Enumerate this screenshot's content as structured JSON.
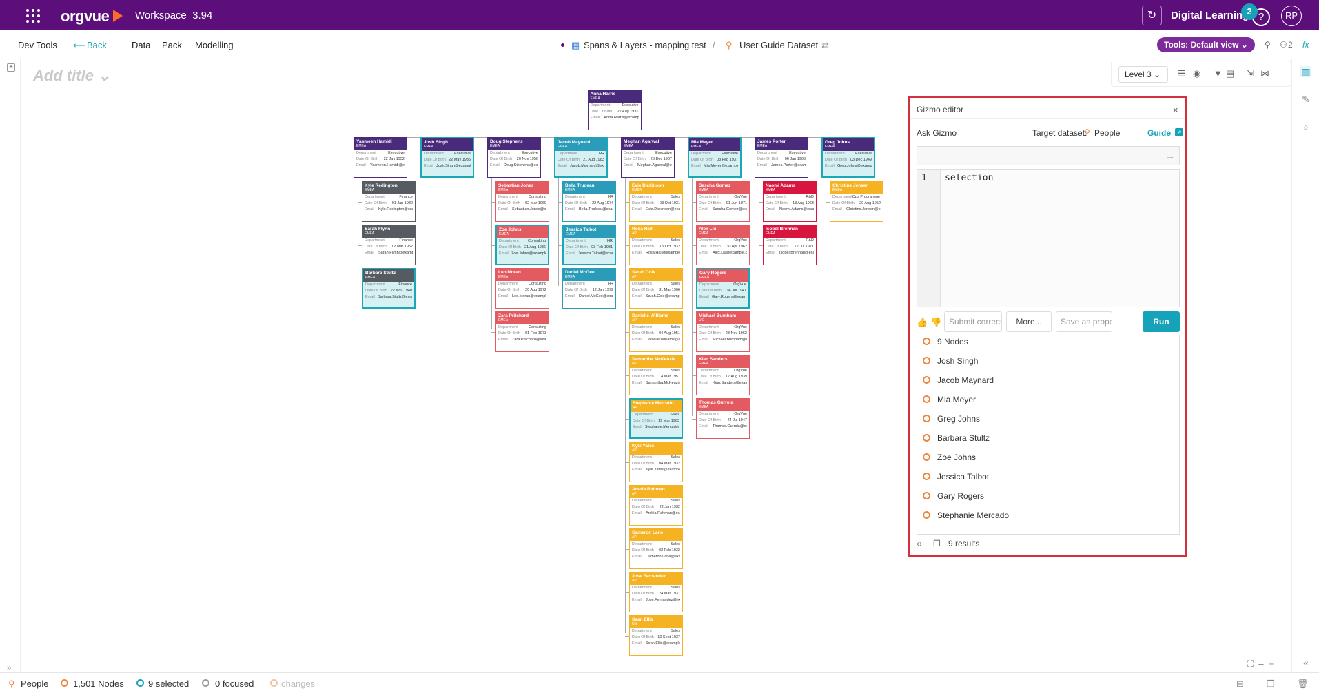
{
  "app": {
    "workspace_label": "Workspace",
    "version": "3.94",
    "logo_text": "orgvue",
    "user_name": "Digital Learning",
    "notifications": "2",
    "avatar_initials": "RP",
    "help_glyph": "?"
  },
  "menu": {
    "dev_tools": "Dev Tools",
    "back": "Back",
    "data": "Data",
    "pack": "Pack",
    "modelling": "Modelling",
    "crumb1": "Spans & Layers - mapping test",
    "crumb_sep": "/",
    "crumb2": "User Guide Dataset",
    "tools_btn": "Tools: Default view ⌄",
    "counter": "2",
    "fx": "fx"
  },
  "canvas": {
    "add_title": "Add title ⌄",
    "level": "Level 3 ⌄"
  },
  "gizmo": {
    "title": "Gizmo editor",
    "close": "×",
    "ask": "Ask Gizmo",
    "target_label": "Target dataset:",
    "target_value": "People",
    "guide": "Guide",
    "line_number": "1",
    "code": "selection",
    "submit": "Submit correct",
    "more": "More...",
    "save": "Save as prope",
    "run": "Run",
    "result_head": "9 Nodes",
    "results": [
      "Josh Singh",
      "Jacob Maynard",
      "Mia Meyer",
      "Greg Johns",
      "Barbara Stultz",
      "Zoe Johns",
      "Jessica Talbot",
      "Gary Rogers",
      "Stephanie Mercado"
    ],
    "footer": "9 results"
  },
  "status": {
    "dataset": "People",
    "nodes": "1,501 Nodes",
    "selected": "9 selected",
    "focused": "0 focused",
    "changes": "changes"
  },
  "colors": {
    "topbar": "#5c0f7a",
    "accent": "#16a2b8",
    "highlight": "#d32f3f"
  },
  "org": {
    "root": {
      "name": "Anna Harris",
      "region": "EMEA",
      "dept": "Executive",
      "dob": "22 Aug 1931",
      "email": "Anna.Harris@example.com",
      "color": "#4a2a7a"
    },
    "columns": [
      {
        "head": {
          "name": "Yasmeen Hamidi",
          "region": "EMEA",
          "dept": "Executive",
          "dob": "22 Jan 1952",
          "email": "Yasmeen.Hamidi@example.com",
          "color": "#4a2a7a"
        },
        "kids": [
          {
            "name": "Kyle Redington",
            "region": "EMEA",
            "dept": "Finance",
            "dob": "01 Jan 1982",
            "email": "Kyle.Redington@example.com",
            "color": "#555b61"
          },
          {
            "name": "Sarah Flynn",
            "region": "EMEA",
            "dept": "Finance",
            "dob": "12 Mar 1952",
            "email": "Sarah.Flynn@example.com",
            "color": "#555b61"
          },
          {
            "name": "Barbara Stultz",
            "region": "EMEA",
            "dept": "Finance",
            "dob": "22 Nov 1940",
            "email": "Barbara.Stultz@example.com",
            "color": "#555b61",
            "sel": true
          }
        ]
      },
      {
        "head": {
          "name": "Josh Singh",
          "region": "EMEA",
          "dept": "Executive",
          "dob": "22 May 1935",
          "email": "Josh.Singh@example.com",
          "color": "#4a2a7a",
          "sel": true
        },
        "kids": []
      },
      {
        "head": {
          "name": "Doug Stephens",
          "region": "EMEA",
          "dept": "Executive",
          "dob": "20 Nov 1956",
          "email": "Doug.Stephens@example.com",
          "color": "#4a2a7a"
        },
        "kids": [
          {
            "name": "Sebastian Jones",
            "region": "EMEA",
            "dept": "Consulting",
            "dob": "02 Mar 1969",
            "email": "Sebastian.Jones@example.com",
            "color": "#e45a61"
          },
          {
            "name": "Zoe Johns",
            "region": "EMEA",
            "dept": "Consulting",
            "dob": "21 Aug 1936",
            "email": "Zoe.Johns@example.com",
            "color": "#e45a61",
            "sel": true
          },
          {
            "name": "Leo Moran",
            "region": "EMEA",
            "dept": "Consulting",
            "dob": "20 Aug 1972",
            "email": "Leo.Moran@example.com",
            "color": "#e45a61"
          },
          {
            "name": "Zara Pritchard",
            "region": "EMEA",
            "dept": "Consulting",
            "dob": "01 Feb 1973",
            "email": "Zara.Pritchard@example.com",
            "color": "#e45a61"
          }
        ]
      },
      {
        "head": {
          "name": "Jacob Maynard",
          "region": "EMEA",
          "dept": "HR",
          "dob": "21 Aug 1983",
          "email": "Jacob.Maynard@example.com",
          "color": "#2a9bb8",
          "sel": true
        },
        "kids": [
          {
            "name": "Bella Trudeau",
            "region": "EMEA",
            "dept": "HR",
            "dob": "22 Aug 1974",
            "email": "Bella.Trudeau@example.com",
            "color": "#2a9bb8"
          },
          {
            "name": "Jessica Talbot",
            "region": "EMEA",
            "dept": "HR",
            "dob": "03 Feb 1931",
            "email": "Jessica.Talbot@example.com",
            "color": "#2a9bb8",
            "sel": true
          },
          {
            "name": "Daniel McGee",
            "region": "EMEA",
            "dept": "HR",
            "dob": "12 Jan 1972",
            "email": "Daniel.McGee@example.com",
            "color": "#2a9bb8"
          }
        ]
      },
      {
        "head": {
          "name": "Meghan Agarwal",
          "region": "EMEA",
          "dept": "Executive",
          "dob": "26 Dec 1967",
          "email": "Meghan.Agarwal@example.com",
          "color": "#4a2a7a"
        },
        "kids": [
          {
            "name": "Evie Dickinson",
            "region": "EMEA",
            "dept": "Sales",
            "dob": "03 Oct 1931",
            "email": "Evie.Dickinson@example.com",
            "color": "#f5b324"
          },
          {
            "name": "Rosa Hall",
            "region": "AP",
            "dept": "Sales",
            "dob": "15 Oct 1932",
            "email": "Rosa.Hall@example.com",
            "color": "#f5b324"
          },
          {
            "name": "Sarah Cole",
            "region": "AP",
            "dept": "Sales",
            "dob": "31 Mar 1966",
            "email": "Sarah.Cole@example.com",
            "color": "#f5b324"
          },
          {
            "name": "Danielle Williams",
            "region": "AP",
            "dept": "Sales",
            "dob": "04 Aug 1951",
            "email": "Danielle.Williams@example.com",
            "color": "#f5b324"
          },
          {
            "name": "Samantha McKenzie",
            "region": "AP",
            "dept": "Sales",
            "dob": "14 Mar 1951",
            "email": "Samantha.McKenzie@example.com",
            "color": "#f5b324"
          },
          {
            "name": "Stephanie Mercado",
            "region": "AP",
            "dept": "Sales",
            "dob": "19 Mar 1963",
            "email": "Stephanie.Mercado@example.com",
            "color": "#f5b324",
            "sel": true
          },
          {
            "name": "Kyle Yates",
            "region": "AP",
            "dept": "Sales",
            "dob": "04 Mar 1932",
            "email": "Kyle.Yates@example.com",
            "color": "#f5b324"
          },
          {
            "name": "Arshia Rahman",
            "region": "AP",
            "dept": "Sales",
            "dob": "22 Jan 1932",
            "email": "Arshia.Rahman@example.com",
            "color": "#f5b324"
          },
          {
            "name": "Cameron Lane",
            "region": "AP",
            "dept": "Sales",
            "dob": "02 Feb 1932",
            "email": "Cameron.Lane@example.com",
            "color": "#f5b324"
          },
          {
            "name": "Jose Fernandez",
            "region": "AP",
            "dept": "Sales",
            "dob": "24 Mar 1937",
            "email": "Jose.Fernandez@example.com",
            "color": "#f5b324"
          },
          {
            "name": "Sean Ellis",
            "region": "US",
            "dept": "Sales",
            "dob": "10 Sept 1937",
            "email": "Sean.Ellis@example.com",
            "color": "#f5b324"
          }
        ]
      },
      {
        "head": {
          "name": "Mia Meyer",
          "region": "EMEA",
          "dept": "Executive",
          "dob": "03 Feb 1937",
          "email": "Mia.Meyer@example.com",
          "color": "#4a2a7a",
          "sel": true
        },
        "kids": [
          {
            "name": "Sascha Gomez",
            "region": "EMEA",
            "dept": "OrgVue",
            "dob": "01 Jun 1971",
            "email": "Sascha.Gomez@example.com",
            "color": "#e45a61"
          },
          {
            "name": "Alex Liu",
            "region": "EMEA",
            "dept": "OrgVue",
            "dob": "30 Apr 1962",
            "email": "Alex.Liu@example.com",
            "color": "#e45a61"
          },
          {
            "name": "Gary Rogers",
            "region": "EMEA",
            "dept": "OrgVue",
            "dob": "04 Jul 1947",
            "email": "Gary.Rogers@example.com",
            "color": "#e45a61",
            "sel": true
          },
          {
            "name": "Michael Burnham",
            "region": "US",
            "dept": "OrgVue",
            "dob": "28 Nov 1962",
            "email": "Michael.Burnham@example.com",
            "color": "#e45a61"
          },
          {
            "name": "Kian Sanders",
            "region": "EMEA",
            "dept": "OrgVue",
            "dob": "17 Aug 1939",
            "email": "Kian.Sanders@example.com",
            "color": "#e45a61"
          },
          {
            "name": "Thomas Gurrola",
            "region": "EMEA",
            "dept": "OrgVue",
            "dob": "24 Jul 1947",
            "email": "Thomas.Gurrola@example.com",
            "color": "#e45a61"
          }
        ]
      },
      {
        "head": {
          "name": "James Porter",
          "region": "EMEA",
          "dept": "Executive",
          "dob": "06 Jan 1963",
          "email": "James.Porter@example.com",
          "color": "#4a2a7a"
        },
        "kids": [
          {
            "name": "Naomi Adams",
            "region": "EMEA",
            "dept": "R&D",
            "dob": "13 Aug 1963",
            "email": "Naomi.Adams@example.com",
            "color": "#d8153e"
          },
          {
            "name": "Isobel Brennan",
            "region": "EMEA",
            "dept": "R&D",
            "dob": "12 Jul 1971",
            "email": "Isobel.Brennan@example.com",
            "color": "#d8153e"
          }
        ]
      },
      {
        "head": {
          "name": "Greg Johns",
          "region": "EMEA",
          "dept": "Executive",
          "dob": "03 Dec 1949",
          "email": "Greg.Johns@example.com",
          "color": "#4a2a7a",
          "sel": true
        },
        "kids": [
          {
            "name": "Christine Jensen",
            "region": "EMEA",
            "dept": "Ops Programme Delivery",
            "dob": "20 Aug 1952",
            "email": "Christine.Jensen@example.com",
            "color": "#f5b324"
          }
        ]
      }
    ]
  }
}
